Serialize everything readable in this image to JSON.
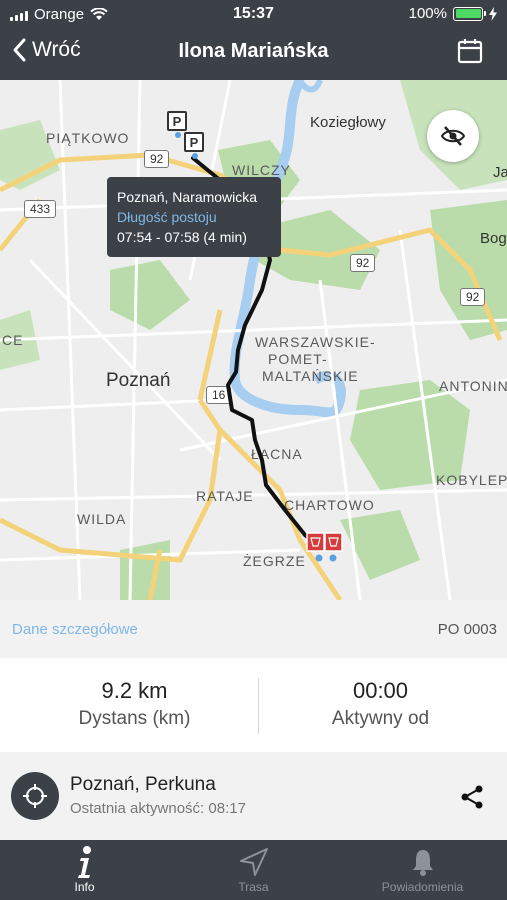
{
  "status_bar": {
    "carrier": "Orange",
    "time": "15:37",
    "battery": "100%",
    "battery_color": "#4cd964"
  },
  "nav": {
    "back_label": "Wróć",
    "title": "Ilona Mariańska",
    "calendar_icon": "calendar-icon",
    "back_icon": "chevron-left-icon"
  },
  "map": {
    "labels": {
      "piatkowo": "PIĄTKOWO",
      "koziegłowy": "Koziegłowy",
      "wilczy": "WILCZY",
      "ja": "Ja",
      "bog": "Bog",
      "ce": "CE",
      "warszawskie": "WARSZAWSKIE-",
      "pomet": "POMET-",
      "maltanskie": "MALTAŃSKIE",
      "antonin": "ANTONIN",
      "poznan": "Poznań",
      "lacna": "ŁACNA",
      "rataje": "RATAJE",
      "chartowo": "CHARTOWO",
      "kobylep": "KOBYLEP",
      "wilda": "WILDA",
      "zegrze": "ŻEGRZE"
    },
    "shields": {
      "s433": "433",
      "s92a": "92",
      "s92b": "92",
      "s92c": "92",
      "s16": "16"
    },
    "parking_label": "P",
    "tooltip": {
      "place": "Poznań, Naramowicka",
      "link": "Długość postoju",
      "time": "07:54 - 07:58 (4 min)"
    },
    "route_color": "#111111",
    "hide_icon": "eye-slash-icon"
  },
  "details": {
    "link": "Dane szczegółowe",
    "plate": "PO 0003"
  },
  "stats": {
    "distance_value": "9.2 km",
    "distance_label": "Dystans (km)",
    "active_value": "00:00",
    "active_label": "Aktywny od"
  },
  "location": {
    "name": "Poznań, Perkuna",
    "last_activity": "Ostatnia aktywność: 08:17",
    "icon": "crosshair-icon",
    "share_icon": "share-icon"
  },
  "tabs": [
    {
      "label": "Info",
      "icon": "info-icon"
    },
    {
      "label": "Trasa",
      "icon": "navigation-arrow-icon"
    },
    {
      "label": "Powiadomienia",
      "icon": "bell-icon"
    }
  ]
}
